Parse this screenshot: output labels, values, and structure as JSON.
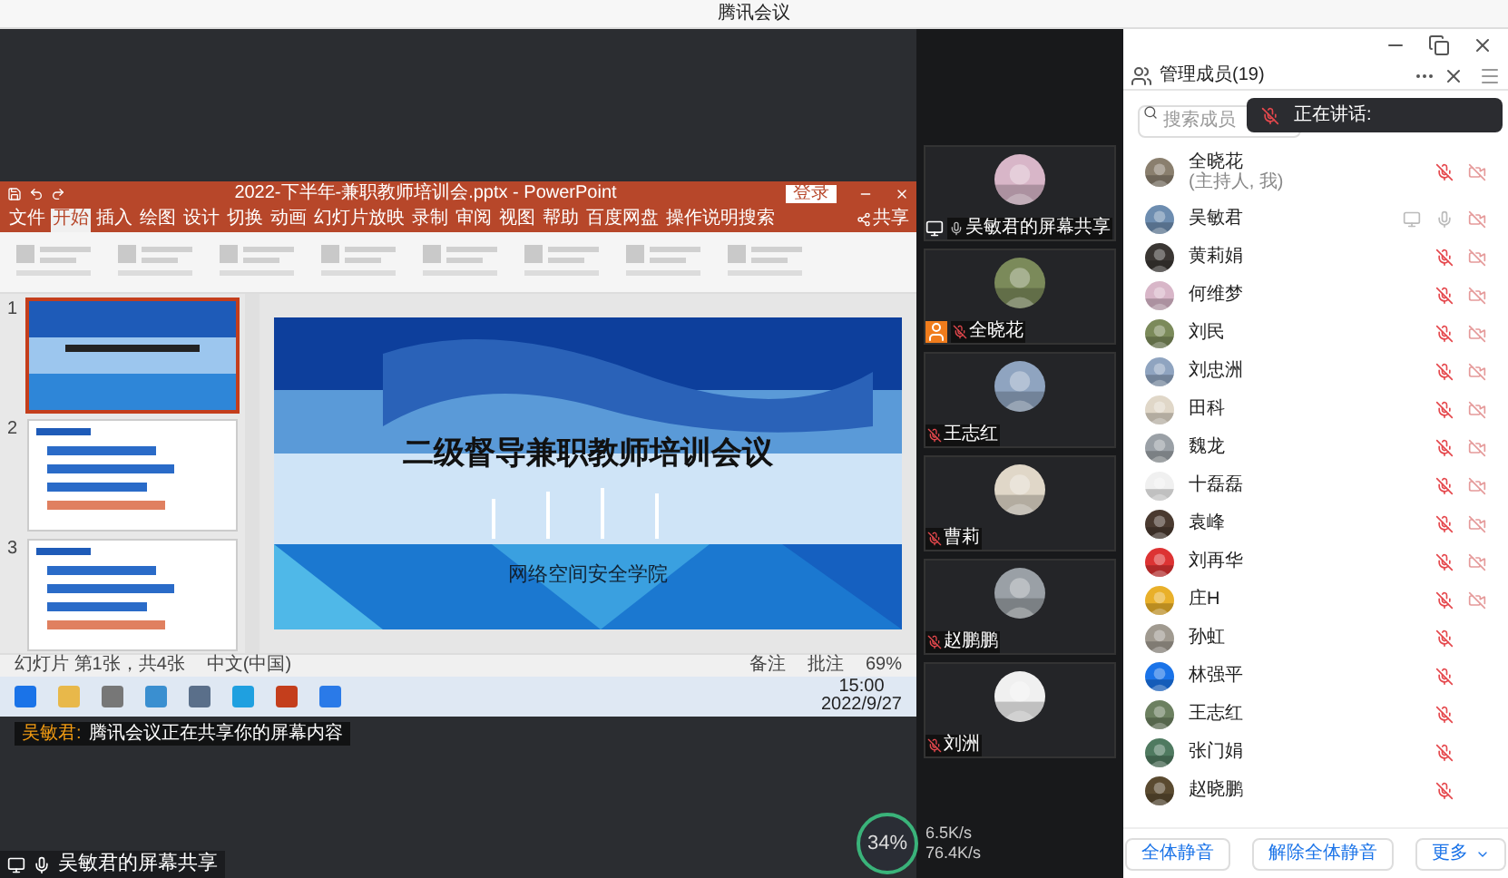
{
  "window": {
    "title": "腾讯会议"
  },
  "share_view": {
    "ppt": {
      "title": "2022-下半年-兼职教师培训会.pptx - PowerPoint",
      "login": "登录",
      "tabs": [
        {
          "label": "文件",
          "selected": false
        },
        {
          "label": "开始",
          "selected": true
        },
        {
          "label": "插入",
          "selected": false
        },
        {
          "label": "绘图",
          "selected": false
        },
        {
          "label": "设计",
          "selected": false
        },
        {
          "label": "切换",
          "selected": false
        },
        {
          "label": "动画",
          "selected": false
        },
        {
          "label": "幻灯片放映",
          "selected": false
        },
        {
          "label": "录制",
          "selected": false
        },
        {
          "label": "审阅",
          "selected": false
        },
        {
          "label": "视图",
          "selected": false
        },
        {
          "label": "帮助",
          "selected": false
        },
        {
          "label": "百度网盘",
          "selected": false
        },
        {
          "label": "操作说明搜索",
          "selected": false
        }
      ],
      "share": "共享",
      "thumbnails": [
        {
          "number": "1",
          "selected": true
        },
        {
          "number": "2",
          "selected": false
        },
        {
          "number": "3",
          "selected": false
        }
      ],
      "slide": {
        "title": "二级督导兼职教师培训会议",
        "subtitle": "网络空间安全学院"
      },
      "status": {
        "slide_info": "幻灯片 第1张，共4张",
        "language": "中文(中国)",
        "notes": "备注",
        "comments": "批注",
        "zoom": "69%"
      },
      "taskbar": {
        "time": "15:00",
        "date": "2022/9/27"
      }
    },
    "caption": {
      "speaker": "吴敏君:",
      "text": "腾讯会议正在共享你的屏幕内容"
    },
    "share_label": "吴敏君的屏幕共享",
    "network": {
      "usage": "34%",
      "upload": "6.5K/s",
      "download": "76.4K/s"
    }
  },
  "video_tiles": [
    {
      "name": "吴敏君的屏幕共享",
      "mic_muted": false,
      "sharing": true,
      "host": false
    },
    {
      "name": "全晓花",
      "mic_muted": true,
      "sharing": false,
      "host": true
    },
    {
      "name": "王志红",
      "mic_muted": true,
      "sharing": false,
      "host": false
    },
    {
      "name": "曹莉",
      "mic_muted": true,
      "sharing": false,
      "host": false
    },
    {
      "name": "赵鹏鹏",
      "mic_muted": true,
      "sharing": false,
      "host": false
    },
    {
      "name": "刘洲",
      "mic_muted": true,
      "sharing": false,
      "host": false
    }
  ],
  "members": {
    "title": "管理成员(19)",
    "search_placeholder": "搜索成员",
    "speaking": "正在讲话:",
    "list": [
      {
        "name": "全晓花",
        "note": "(主持人, 我)",
        "mic_muted": true,
        "camera_shown": true,
        "sharing": false
      },
      {
        "name": "吴敏君",
        "mic_muted": false,
        "camera_shown": true,
        "sharing": true
      },
      {
        "name": "黄莉娟",
        "mic_muted": true,
        "camera_shown": true,
        "sharing": false
      },
      {
        "name": "何维梦",
        "mic_muted": true,
        "camera_shown": true,
        "sharing": false
      },
      {
        "name": "刘民",
        "mic_muted": true,
        "camera_shown": true,
        "sharing": false
      },
      {
        "name": "刘忠洲",
        "mic_muted": true,
        "camera_shown": true,
        "sharing": false
      },
      {
        "name": "田科",
        "mic_muted": true,
        "camera_shown": true,
        "sharing": false
      },
      {
        "name": "魏龙",
        "mic_muted": true,
        "camera_shown": true,
        "sharing": false
      },
      {
        "name": "十磊磊",
        "mic_muted": true,
        "camera_shown": true,
        "sharing": false
      },
      {
        "name": "袁峰",
        "mic_muted": true,
        "camera_shown": true,
        "sharing": false
      },
      {
        "name": "刘再华",
        "mic_muted": true,
        "camera_shown": true,
        "sharing": false
      },
      {
        "name": "庄H",
        "mic_muted": true,
        "camera_shown": true,
        "sharing": false
      },
      {
        "name": "孙虹",
        "mic_muted": true,
        "camera_shown": false,
        "sharing": false
      },
      {
        "name": "林强平",
        "mic_muted": true,
        "camera_shown": false,
        "sharing": false
      },
      {
        "name": "王志红",
        "mic_muted": true,
        "camera_shown": false,
        "sharing": false
      },
      {
        "name": "张门娟",
        "mic_muted": true,
        "camera_shown": false,
        "sharing": false
      },
      {
        "name": "赵晓鹏",
        "mic_muted": true,
        "camera_shown": false,
        "sharing": false
      }
    ],
    "buttons": [
      "全体静音",
      "解除全体静音",
      "更多"
    ]
  }
}
